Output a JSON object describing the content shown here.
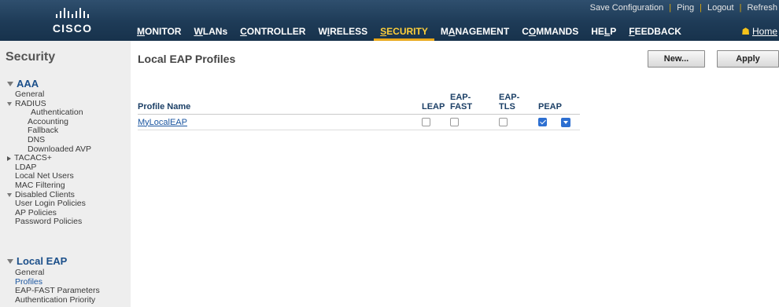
{
  "brand": {
    "logo_text": "CISCO"
  },
  "util_links": [
    {
      "label": "Save Configuration"
    },
    {
      "label": "Ping"
    },
    {
      "label": "Logout"
    },
    {
      "label": "Refresh"
    }
  ],
  "nav": [
    {
      "pre": "",
      "u": "M",
      "post": "ONITOR",
      "active": false
    },
    {
      "pre": "",
      "u": "W",
      "post": "LANs",
      "active": false
    },
    {
      "pre": "",
      "u": "C",
      "post": "ONTROLLER",
      "active": false
    },
    {
      "pre": "W",
      "u": "I",
      "post": "RELESS",
      "active": false
    },
    {
      "pre": "",
      "u": "S",
      "post": "ECURITY",
      "active": true
    },
    {
      "pre": "M",
      "u": "A",
      "post": "NAGEMENT",
      "active": false
    },
    {
      "pre": "C",
      "u": "O",
      "post": "MMANDS",
      "active": false
    },
    {
      "pre": "HE",
      "u": "L",
      "post": "P",
      "active": false
    },
    {
      "pre": "",
      "u": "F",
      "post": "EEDBACK",
      "active": false
    }
  ],
  "home": {
    "label": "Home",
    "icon": "home-icon"
  },
  "sidebar": {
    "title": "Security",
    "aaa": {
      "label": "AAA",
      "items": [
        {
          "label": "General",
          "cls": "l1"
        },
        {
          "label": "RADIUS",
          "cls": "l1x",
          "toggle": "down"
        },
        {
          "label": "Authentication",
          "cls": "l2b"
        },
        {
          "label": "Accounting",
          "cls": "l2"
        },
        {
          "label": "Fallback",
          "cls": "l2"
        },
        {
          "label": "DNS",
          "cls": "l2"
        },
        {
          "label": "Downloaded AVP",
          "cls": "l2"
        },
        {
          "label": "TACACS+",
          "cls": "l1x",
          "toggle": "right"
        },
        {
          "label": "LDAP",
          "cls": "l1"
        },
        {
          "label": "Local Net Users",
          "cls": "l1"
        },
        {
          "label": "MAC Filtering",
          "cls": "l1"
        },
        {
          "label": "Disabled Clients",
          "cls": "l1x",
          "toggle": "down"
        },
        {
          "label": "User Login Policies",
          "cls": "l1"
        },
        {
          "label": "AP Policies",
          "cls": "l1"
        },
        {
          "label": "Password Policies",
          "cls": "l1"
        }
      ]
    },
    "local_eap": {
      "label": "Local EAP",
      "items": [
        {
          "label": "General",
          "cls": "l1"
        },
        {
          "label": "Profiles",
          "cls": "l1",
          "active": true
        },
        {
          "label": "EAP-FAST Parameters",
          "cls": "l1"
        },
        {
          "label": "Authentication Priority",
          "cls": "l1"
        }
      ]
    }
  },
  "page": {
    "title": "Local EAP Profiles",
    "new_button": "New...",
    "apply_button": "Apply"
  },
  "table": {
    "columns": {
      "profile_name": "Profile Name",
      "leap": "LEAP",
      "eap_fast_1": "EAP-",
      "eap_fast_2": "FAST",
      "eap_tls_1": "EAP-",
      "eap_tls_2": "TLS",
      "peap": "PEAP"
    },
    "rows": [
      {
        "name": "MyLocalEAP",
        "leap": false,
        "eap_fast": false,
        "eap_tls": false,
        "peap": true
      }
    ]
  },
  "colors": {
    "banner": "#1e3b57",
    "active_nav": "#ffcf3a",
    "link": "#1a55a0",
    "checkbox_accent": "#2d6fd1"
  }
}
